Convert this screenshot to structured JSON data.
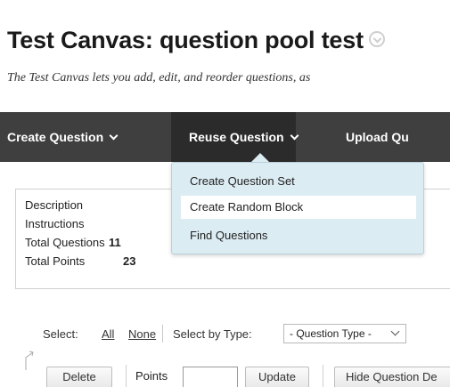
{
  "header": {
    "title": "Test Canvas: question pool test",
    "subtitle": "The Test Canvas lets you add, edit, and reorder questions, as"
  },
  "action_bar": {
    "create_question": "Create Question",
    "reuse_question": "Reuse Question",
    "upload_questions": "Upload Qu"
  },
  "reuse_menu": {
    "items": [
      "Create Question Set",
      "Create Random Block",
      "Find Questions"
    ]
  },
  "info": {
    "description_label": "Description",
    "instructions_label": "Instructions",
    "total_questions_label": "Total Questions",
    "total_questions_value": "11",
    "total_points_label": "Total Points",
    "total_points_value": "23"
  },
  "select_bar": {
    "select_label": "Select:",
    "all_link": "All",
    "none_link": "None",
    "select_by_type_label": "Select by Type:",
    "question_type_value": "- Question Type -"
  },
  "toolbar": {
    "delete_label": "Delete",
    "points_label": "Points",
    "points_value": "",
    "update_label": "Update",
    "hide_details_label": "Hide Question De"
  },
  "colors": {
    "action_bar_bg": "#3f3f3f",
    "action_active_bg": "#2b2b2b",
    "menu_bg": "#dcecf3",
    "menu_highlight": "#ffffff"
  }
}
